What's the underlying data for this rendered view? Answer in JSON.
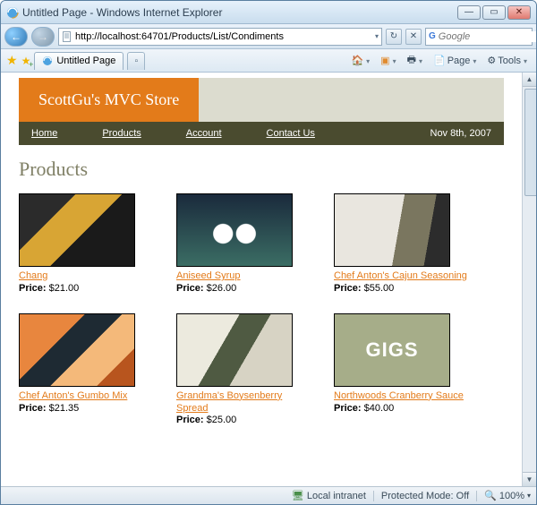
{
  "window": {
    "title": "Untitled Page - Windows Internet Explorer",
    "min": "—",
    "max": "▭",
    "close": "✕"
  },
  "address": {
    "url": "http://localhost:64701/Products/List/Condiments"
  },
  "search": {
    "provider": "Google"
  },
  "tab": {
    "title": "Untitled Page"
  },
  "tools": {
    "page": "Page",
    "tools": "Tools"
  },
  "site": {
    "brand": "ScottGu's MVC Store",
    "nav": {
      "home": "Home",
      "products": "Products",
      "account": "Account",
      "contact": "Contact Us"
    },
    "date": "Nov 8th, 2007"
  },
  "page": {
    "heading": "Products",
    "price_label": "Price:"
  },
  "products": [
    {
      "name": "Chang ",
      "price": "$21.00"
    },
    {
      "name": "Aniseed Syrup ",
      "price": "$26.00"
    },
    {
      "name": "Chef Anton's Cajun Seasoning ",
      "price": "$55.00"
    },
    {
      "name": "Chef Anton's Gumbo Mix ",
      "price": "$21.35"
    },
    {
      "name": "Grandma's Boysenberry Spread ",
      "price": "$25.00"
    },
    {
      "name": "Northwoods Cranberry Sauce ",
      "price": "$40.00"
    }
  ],
  "status": {
    "zone": "Local intranet",
    "protected": "Protected Mode: Off",
    "zoom": "100%"
  }
}
